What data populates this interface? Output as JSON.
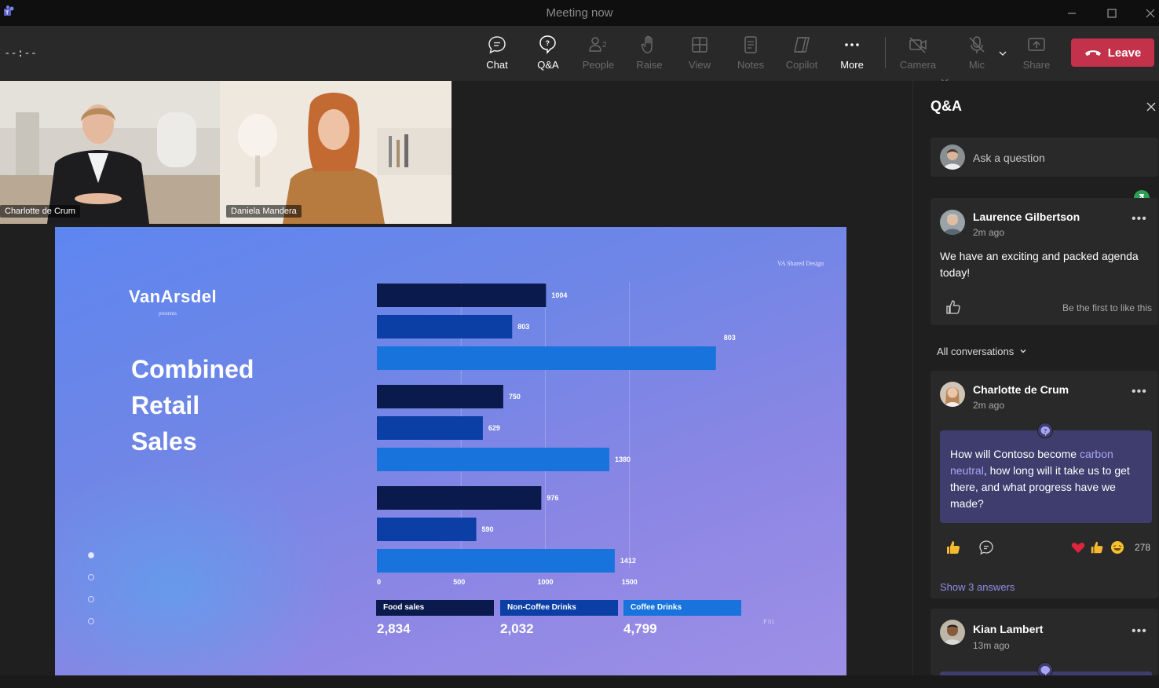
{
  "window": {
    "title": "Meeting now",
    "controls": [
      "minimize-icon",
      "maximize-icon",
      "close-icon"
    ]
  },
  "toolbar": {
    "timer": "--:--",
    "buttons": [
      {
        "label": "Chat",
        "icon": "chat-icon",
        "state": "enabled"
      },
      {
        "label": "Q&A",
        "icon": "qa-icon",
        "state": "active"
      },
      {
        "label": "People",
        "icon": "people-icon",
        "badge": "2",
        "state": "disabled"
      },
      {
        "label": "Raise",
        "icon": "raise-hand-icon",
        "state": "disabled"
      },
      {
        "label": "View",
        "icon": "view-icon",
        "state": "disabled"
      },
      {
        "label": "Notes",
        "icon": "notes-icon",
        "state": "disabled"
      },
      {
        "label": "Copilot",
        "icon": "copilot-icon",
        "state": "disabled"
      },
      {
        "label": "More",
        "icon": "more-icon",
        "state": "enabled"
      },
      {
        "label": "Camera",
        "icon": "camera-off-icon",
        "state": "disabled"
      },
      {
        "label": "Mic",
        "icon": "mic-off-icon",
        "state": "disabled"
      },
      {
        "label": "Share",
        "icon": "share-icon",
        "state": "disabled"
      }
    ],
    "leave_label": "Leave"
  },
  "participants": [
    {
      "name": "Charlotte de Crum"
    },
    {
      "name": "Daniela Mandera"
    }
  ],
  "slide": {
    "logo": "VanArsdel",
    "presents": "presents",
    "shared_label": "VA Shared Design",
    "headline": [
      "Combined",
      "Retail",
      "Sales"
    ],
    "page_number": "P 01",
    "pagination_dots": 4,
    "active_dot": 0
  },
  "chart_data": {
    "type": "bar",
    "orientation": "horizontal",
    "xlim": [
      0,
      1500
    ],
    "x_ticks": [
      "0",
      "500",
      "1000",
      "1500"
    ],
    "grid": true,
    "bars": [
      {
        "series": "Food sales",
        "value": 1004,
        "label": "1004"
      },
      {
        "series": "Non-Coffee Drinks",
        "value": 803,
        "label": "803"
      },
      {
        "series": "Coffee Drinks",
        "value": 2025,
        "label": "803"
      },
      {
        "series": "Food sales",
        "value": 750,
        "label": "750"
      },
      {
        "series": "Non-Coffee Drinks",
        "value": 629,
        "label": "629"
      },
      {
        "series": "Coffee Drinks",
        "value": 1380,
        "label": "1380"
      },
      {
        "series": "Food sales",
        "value": 976,
        "label": "976"
      },
      {
        "series": "Non-Coffee Drinks",
        "value": 590,
        "label": "590"
      },
      {
        "series": "Coffee Drinks",
        "value": 1412,
        "label": "1412"
      }
    ],
    "series": [
      {
        "name": "Food sales",
        "color": "#0b1a4c",
        "total": "2,834"
      },
      {
        "name": "Non-Coffee Drinks",
        "color": "#0b3fa6",
        "total": "2,032"
      },
      {
        "name": "Coffee Drinks",
        "color": "#1874dc",
        "total": "4,799"
      }
    ]
  },
  "qa": {
    "title": "Q&A",
    "ask_placeholder": "Ask a question",
    "pinned": {
      "author": "Laurence Gilbertson",
      "time": "2m ago",
      "text": "We have an exciting and packed agenda today!",
      "like_prompt": "Be the first to like this"
    },
    "filter": "All conversations",
    "questions": [
      {
        "author": "Charlotte de Crum",
        "time": "2m ago",
        "text_before": "How will Contoso become ",
        "text_highlight": "carbon neutral",
        "text_after": ", how long will it take us to get there, and what progress have we made?",
        "reaction_count": "278",
        "show_answers": "Show 3 answers"
      },
      {
        "author": "Kian Lambert",
        "time": "13m ago"
      }
    ]
  }
}
